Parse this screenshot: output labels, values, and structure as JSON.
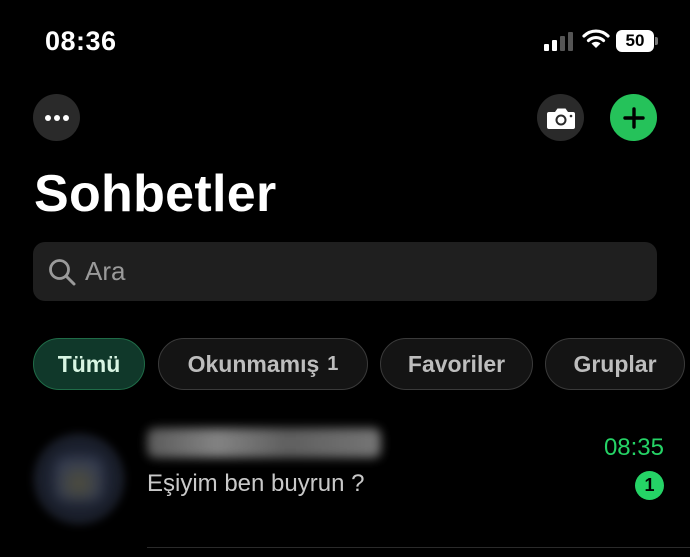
{
  "status_bar": {
    "time": "08:36",
    "battery": "50"
  },
  "header": {
    "title": "Sohbetler"
  },
  "search": {
    "placeholder": "Ara"
  },
  "filters": [
    {
      "label": "Tümü",
      "active": true
    },
    {
      "label": "Okunmamış",
      "count": "1"
    },
    {
      "label": "Favoriler"
    },
    {
      "label": "Gruplar"
    }
  ],
  "chats": [
    {
      "preview": "Eşiyim ben buyrun ?",
      "time": "08:35",
      "unread": "1"
    }
  ],
  "colors": {
    "accent": "#25d366",
    "new_chat_button": "#25c25a",
    "active_chip_bg": "#10382a"
  },
  "icons": [
    "more-icon",
    "camera-icon",
    "plus-icon",
    "search-icon",
    "wifi-icon",
    "signal-icon",
    "battery-icon"
  ]
}
